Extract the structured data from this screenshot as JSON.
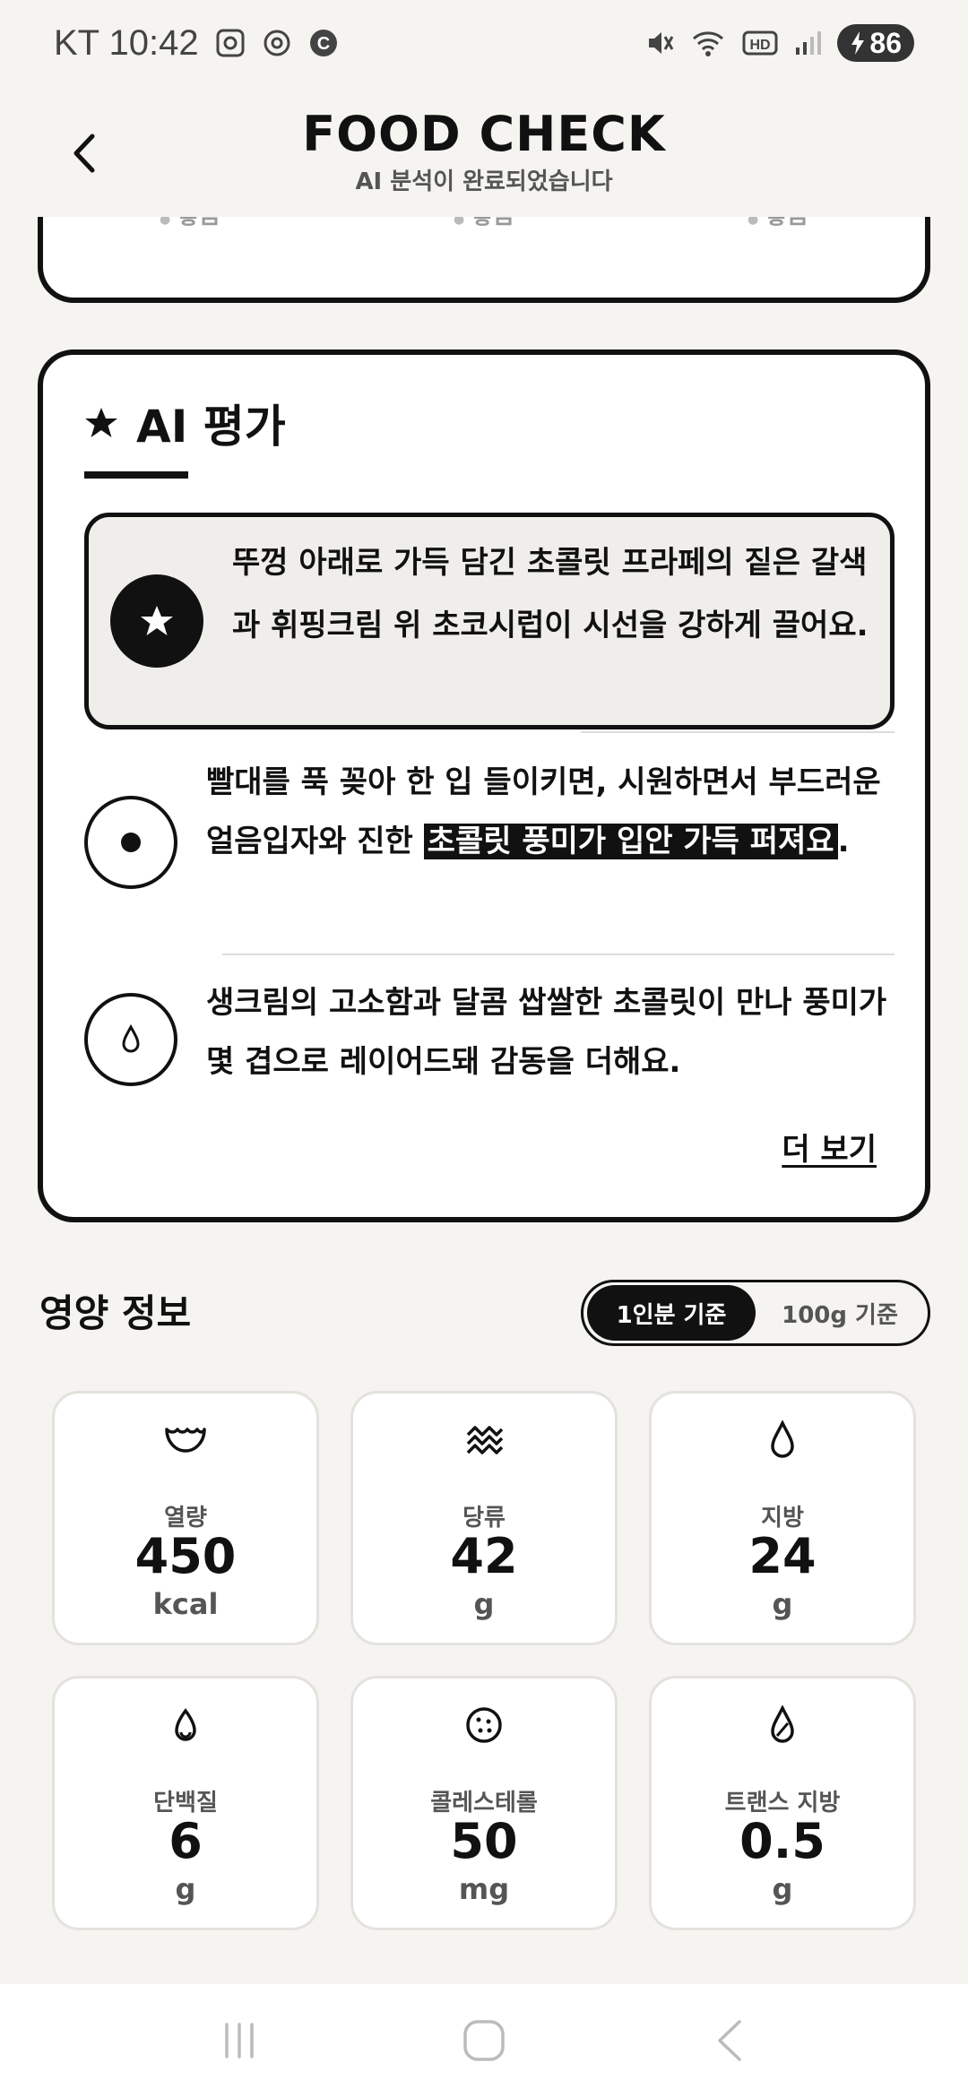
{
  "status_bar": {
    "carrier_time": "KT 10:42",
    "battery": "86",
    "icons": [
      "screenshot-icon",
      "openai-icon",
      "c-icon",
      "mute-icon",
      "wifi-icon",
      "hd-icon",
      "signal-icon",
      "battery-icon"
    ]
  },
  "header": {
    "title": "FOOD CHECK",
    "subtitle": "AI 분석이 완료되었습니다",
    "back_icon": "chevron-left-icon"
  },
  "top_card": {
    "items": [
      "좋음",
      "좋음",
      "좋음"
    ]
  },
  "ai_card": {
    "title": "AI 평가",
    "highlight": "뚜껑 아래로 가득 담긴 초콜릿 프라페의 짙은 갈색과 휘핑크림 위 초코시럽이 시선을 강하게 끌어요.",
    "point1_pre": "빨대를 푹 꽂아 한 입 들이키면, 시원하면서 부드러운 얼음입자와 진한 ",
    "point1_mark": "초콜릿 풍미가 입안 가득 퍼져요",
    "point1_post": ".",
    "point2": "생크림의 고소함과 달콤 쌉쌀한 초콜릿이 만나 풍미가 몇 겹으로 레이어드돼 감동을 더해요.",
    "more": "더 보기"
  },
  "nutrition": {
    "title": "영양 정보",
    "toggle": [
      "1인분 기준",
      "100g 기준"
    ],
    "selected": "1인분 기준",
    "items": [
      {
        "label": "열량",
        "value": "450",
        "unit": "kcal",
        "icon": "bowl-icon"
      },
      {
        "label": "당류",
        "value": "42",
        "unit": "g",
        "icon": "sugar-icon"
      },
      {
        "label": "지방",
        "value": "24",
        "unit": "g",
        "icon": "drop-icon"
      },
      {
        "label": "단백질",
        "value": "6",
        "unit": "g",
        "icon": "egg-icon"
      },
      {
        "label": "콜레스테롤",
        "value": "50",
        "unit": "mg",
        "icon": "cookie-icon"
      },
      {
        "label": "트랜스 지방",
        "value": "0.5",
        "unit": "g",
        "icon": "leaf-drop-icon"
      }
    ]
  },
  "colors": {
    "background": "#f5f4f0",
    "accent": "#111111",
    "card": "#ffffff"
  }
}
